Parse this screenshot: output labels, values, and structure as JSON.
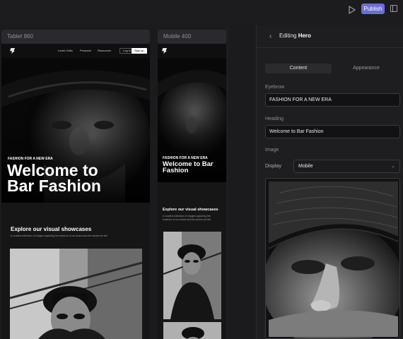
{
  "toolbar": {
    "publish_label": "Publish",
    "play_icon": "play-icon",
    "panel_icon": "panel-toggle-icon"
  },
  "frames": {
    "tablet_label": "Tablet 860",
    "mobile_label": "Mobile 400"
  },
  "site": {
    "nav": {
      "links": [
        "Learn Orillo",
        "Products",
        "Resources"
      ],
      "login": "Log in",
      "signup": "Sign up"
    },
    "hero": {
      "eyebrow": "FASHION FOR A NEW ERA",
      "heading": "Welcome to Bar Fashion"
    },
    "showcase": {
      "title": "Explore our visual showcases",
      "subtitle": "A curated collection of images capturing the essence of our brand and the stories we tell."
    }
  },
  "panel": {
    "back_icon": "chevron-left-icon",
    "title_prefix": "Editing",
    "title_name": "Hero",
    "tabs": [
      {
        "label": "Content",
        "active": true
      },
      {
        "label": "Appearance",
        "active": false
      }
    ],
    "fields": {
      "eyebrow_label": "Eyebrow",
      "eyebrow_value": "FASHION FOR A NEW ERA",
      "heading_label": "Heading",
      "heading_value": "Welcome to Bar Fashion",
      "image_label": "Image",
      "display_label": "Display",
      "display_value": "Mobile"
    }
  },
  "colors": {
    "accent": "#6b6fd6",
    "background": "#1c1c1e"
  }
}
